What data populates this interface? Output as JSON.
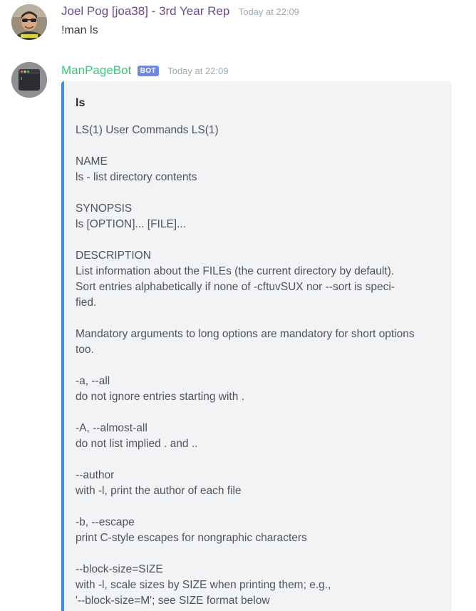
{
  "messages": [
    {
      "username": "Joel Pog [joa38] - 3rd Year Rep",
      "timestamp": "Today at 22:09",
      "text": "!man ls"
    },
    {
      "username": "ManPageBot",
      "bot_tag": "BOT",
      "timestamp": "Today at 22:09",
      "embed": {
        "accent_color": "#3b8ee8",
        "title": "ls",
        "lines": [
          "LS(1) User Commands LS(1)",
          "",
          "NAME",
          "ls - list directory contents",
          "",
          "SYNOPSIS",
          "ls [OPTION]... [FILE]...",
          "",
          "DESCRIPTION",
          "List information about the FILEs (the current directory by default).",
          "Sort entries alphabetically if none of -cftuvSUX nor --sort is speci-",
          "fied.",
          "",
          "Mandatory arguments to long options are mandatory for short options",
          "too.",
          "",
          "-a, --all",
          "do not ignore entries starting with .",
          "",
          "-A, --almost-all",
          "do not list implied . and ..",
          "",
          "--author",
          "with -l, print the author of each file",
          "",
          "-b, --escape",
          "print C-style escapes for nongraphic characters",
          "",
          "--block-size=SIZE",
          "with -l, scale sizes by SIZE when printing them; e.g.,",
          "'--block-size=M'; see SIZE format below"
        ]
      }
    }
  ]
}
